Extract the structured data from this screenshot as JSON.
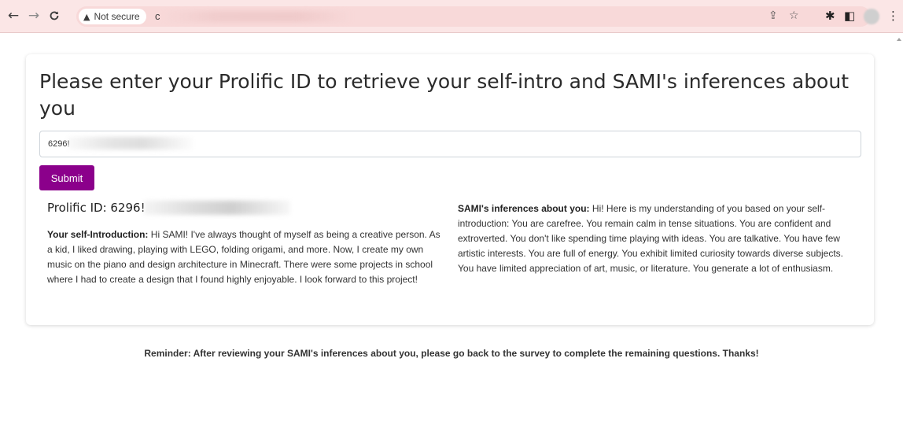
{
  "browser": {
    "security_label": "Not secure",
    "url_fragment": "c"
  },
  "page": {
    "heading": "Please enter your Prolific ID to retrieve your self-intro and SAMI's inferences about you",
    "input": {
      "value": "6296!"
    },
    "submit_label": "Submit",
    "prolific_id_label": "Prolific ID: 6296!",
    "self_intro": {
      "label": "Your self-Introduction:",
      "text": " Hi SAMI! I've always thought of myself as being a creative person. As a kid, I liked drawing, playing with LEGO, folding origami, and more. Now, I create my own music on the piano and design architecture in Minecraft. There were some projects in school where I had to create a design that I found highly enjoyable. I look forward to this project!"
    },
    "inferences": {
      "label": "SAMI's inferences about you:",
      "text": " Hi! Here is my understanding of you based on your self-introduction: You are carefree. You remain calm in tense situations. You are confident and extroverted. You don't like spending time playing with ideas. You are talkative. You have few artistic interests. You are full of energy. You exhibit limited curiosity towards diverse subjects. You have limited appreciation of art, music, or literature. You generate a lot of enthusiasm."
    },
    "reminder": "Reminder: After reviewing your SAMI's inferences about you, please go back to the survey to complete the remaining questions. Thanks!"
  },
  "colors": {
    "submit_bg": "#8b008b",
    "toolbar_bg": "#fbe6e6"
  }
}
